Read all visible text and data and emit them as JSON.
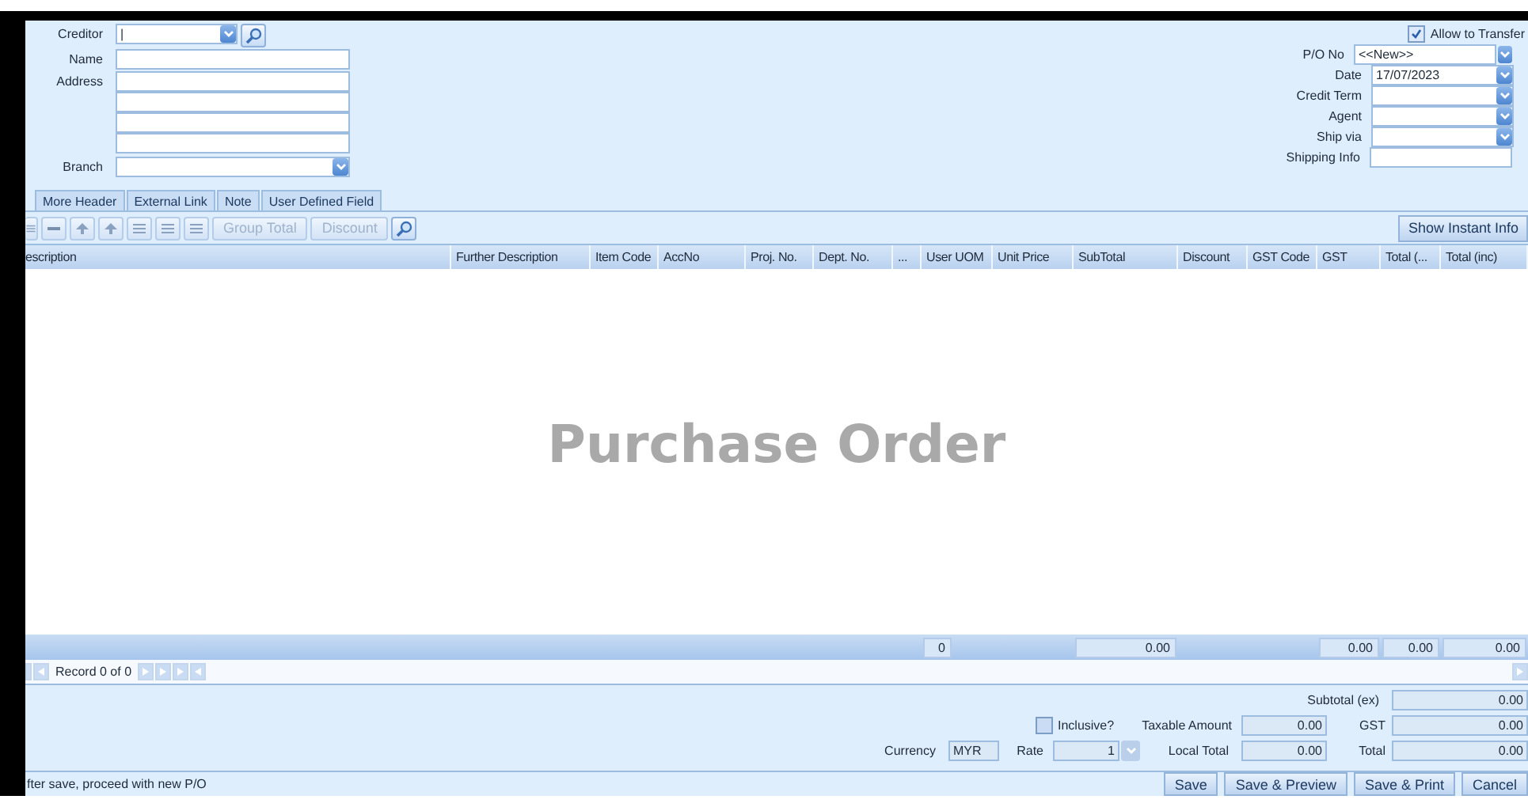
{
  "header": {
    "left_fields": [
      {
        "kind": "combo",
        "label": "Creditor",
        "value": "|",
        "lookup": true
      },
      {
        "kind": "text",
        "label": "Name"
      },
      {
        "kind": "multiline",
        "label": "Address"
      },
      {
        "kind": "combo_wide",
        "label": "Branch"
      }
    ],
    "allow_to_transfer": {
      "label": "Allow to Transfer",
      "checked": true
    },
    "right_fields": [
      {
        "kind": "combo_edge",
        "label": "P/O  No",
        "value": "<<New>>"
      },
      {
        "kind": "combo",
        "label": "Date",
        "value": "17/07/2023"
      },
      {
        "kind": "combo",
        "label": "Credit Term"
      },
      {
        "kind": "combo",
        "label": "Agent"
      },
      {
        "kind": "combo",
        "label": "Ship via"
      },
      {
        "kind": "text",
        "label": "Shipping Info"
      }
    ]
  },
  "tabs": [
    {
      "label": "More Header",
      "selected": false
    },
    {
      "label": "External Link",
      "selected": false
    },
    {
      "label": "Note",
      "selected": false
    },
    {
      "label": "User Defined Field",
      "selected": false
    }
  ],
  "toolbar": {
    "buttons": [
      {
        "label": "Group Total",
        "disabled": true
      },
      {
        "label": "Discount",
        "disabled": true
      }
    ],
    "instant_info": "Show Instant Info"
  },
  "table": {
    "columns": [
      {
        "label": "escription"
      },
      {
        "label": "Further Description"
      },
      {
        "label": "Item Code"
      },
      {
        "label": "AccNo"
      },
      {
        "label": "Proj. No."
      },
      {
        "label": "Dept. No."
      },
      {
        "label": "..."
      },
      {
        "label": "User UOM",
        "total": "0"
      },
      {
        "label": "Unit Price"
      },
      {
        "label": "SubTotal",
        "total": "0.00"
      },
      {
        "label": "Discount"
      },
      {
        "label": "GST Code"
      },
      {
        "label": "GST",
        "total": "0.00"
      },
      {
        "label": "Total (...",
        "total": "0.00"
      },
      {
        "label": "Total (inc)",
        "total": "0.00"
      }
    ],
    "background_text": "Purchase Order"
  },
  "navigator": {
    "record": "Record 0 of 0"
  },
  "summary": {
    "subtotal_ex": {
      "label": "Subtotal (ex)",
      "value": "0.00"
    },
    "inclusive": {
      "label": "Inclusive?",
      "checked": false
    },
    "taxable_amount": {
      "label": "Taxable Amount",
      "value": "0.00"
    },
    "gst": {
      "label": "GST",
      "value": "0.00"
    },
    "currency": {
      "label": "Currency",
      "value": "MYR"
    },
    "rate": {
      "label": "Rate",
      "value": "1"
    },
    "local_total": {
      "label": "Local Total",
      "value": "0.00"
    },
    "total": {
      "label": "Total",
      "value": "0.00"
    }
  },
  "status_bar": {
    "text": "fter save, proceed with new P/O"
  },
  "buttons": [
    {
      "label": "Save"
    },
    {
      "label": "Save & Preview"
    },
    {
      "label": "Save & Print"
    },
    {
      "label": "Cancel"
    }
  ]
}
